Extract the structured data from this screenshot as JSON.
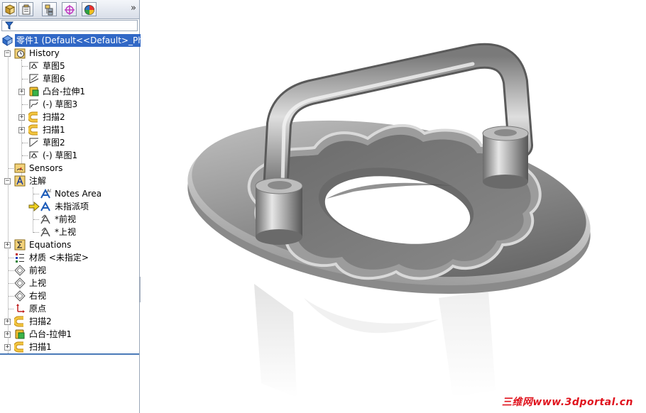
{
  "tree": {
    "root_label": "零件1  (Default<<Default>_Ph",
    "items": [
      {
        "label": "History"
      },
      {
        "label": "草图5"
      },
      {
        "label": "草图6"
      },
      {
        "label": "凸台-拉伸1"
      },
      {
        "label": "(-) 草图3"
      },
      {
        "label": "扫描2"
      },
      {
        "label": "扫描1"
      },
      {
        "label": "草图2"
      },
      {
        "label": "(-) 草图1"
      },
      {
        "label": "Sensors"
      },
      {
        "label": "注解"
      },
      {
        "label": "Notes Area"
      },
      {
        "label": "未指派项"
      },
      {
        "label": "*前视"
      },
      {
        "label": "*上视"
      },
      {
        "label": "Equations"
      },
      {
        "label": "材质 <未指定>"
      },
      {
        "label": "前视"
      },
      {
        "label": "上视"
      },
      {
        "label": "右视"
      },
      {
        "label": "原点"
      },
      {
        "label": "扫描2"
      },
      {
        "label": "凸台-拉伸1"
      },
      {
        "label": "扫描1"
      }
    ]
  },
  "tabs": {
    "more_label": "»"
  },
  "watermark": "三维网www.3dportal.cn",
  "colors": {
    "selection": "#3168c6",
    "panel_border": "#9aa7b8",
    "watermark": "#e0141e"
  }
}
